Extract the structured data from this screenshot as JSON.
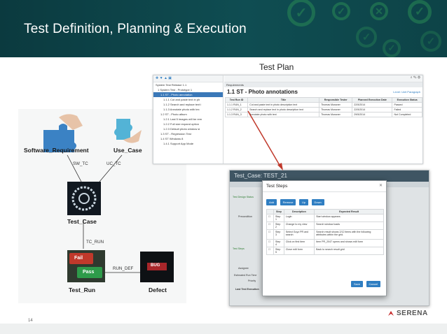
{
  "header": {
    "title": "Test Definition, Planning & Execution"
  },
  "diagram": {
    "nodes": {
      "software_requirement": "Software_Requirement",
      "use_case": "Use_Case",
      "test_case": "Test_Case",
      "test_run": "Test_Run",
      "defect": "Defect"
    },
    "edges": {
      "sw_tc": "SW_TC",
      "uc_tc": "UC_TC",
      "tc_run": "TC_RUN",
      "run_def": "RUN_DEF"
    },
    "image_text": {
      "fail": "Fail",
      "pass": "Pass",
      "bug": "BUG"
    }
  },
  "test_plan": {
    "label": "Test Plan",
    "tree": [
      "System Test Release 1.1",
      "1 System Test - Prototype 1",
      "1.1 ST - Photo annotation",
      "1.1.1 Cut and paste text in ph",
      "1.1.2 Search and replace text i",
      "1.1.3 Annotate photo with tex",
      "1.2 ST - Photo album",
      "1.2.1 Last 5 images will be rem",
      "1.2.2 Full size expand option",
      "1.2.3 Default photo window si",
      "1.3 ST - Regression Test",
      "1.4 ST Windows 8",
      "1.4.1 Support App Mode"
    ],
    "requirements_label": "Requirements",
    "section_title": "1.1 ST - Photo annotations",
    "level_label": "Level: Unit Paragraph",
    "columns": [
      "Test Run ID",
      "Title",
      "Responsible Tester",
      "Planned Execution Date",
      "Execution Status"
    ],
    "rows": [
      [
        "1.1.1 RUN_1",
        "Cut and paste text in photo description text",
        "Thomas Mussner",
        "22/5/2014",
        "Passed"
      ],
      [
        "1.1.2 RUN_2",
        "Search and replace text in photo description text",
        "Thomas Mussner",
        "22/5/2014",
        "Failed"
      ],
      [
        "1.1.3 RUN_3",
        "Annotate photo with text",
        "Thomas Mussner",
        "29/5/2014",
        "Not Completed"
      ]
    ]
  },
  "test_case_window": {
    "title": "Test_Case: TEST_21",
    "modal_title": "Test Steps",
    "toolbar": [
      "Add",
      "Remove",
      "Up",
      "Down"
    ],
    "columns": [
      "Step",
      "Description",
      "Expected Result"
    ],
    "steps": [
      [
        "Step 1",
        "Login",
        "Start window appears"
      ],
      [
        "Step 2",
        "Change to my view",
        "Search window loads"
      ],
      [
        "Step 3",
        "Select Guyz PR and search",
        "Search result shows 2/12 items with the following attributes within the grid."
      ],
      [
        "Step 4",
        "Click on first item",
        "Item PR_2047 opens and shows edit form"
      ],
      [
        "Step 5",
        "Close edit form",
        "Back to search result grid"
      ]
    ],
    "save_label": "Save",
    "cancel_label": "Cancel",
    "side_labels": [
      "Test Design Status",
      "Precondition",
      "Test Steps",
      "Assignee",
      "Estimated Run Time",
      "Priority",
      "Last Test Execution"
    ]
  },
  "footer": {
    "page_number": "14",
    "brand": "SERENA"
  },
  "colors": {
    "banner": "#0f4d52",
    "accent_green": "#2a8a55",
    "link_blue": "#2f7ec2",
    "arrow_red": "#c0392b"
  }
}
